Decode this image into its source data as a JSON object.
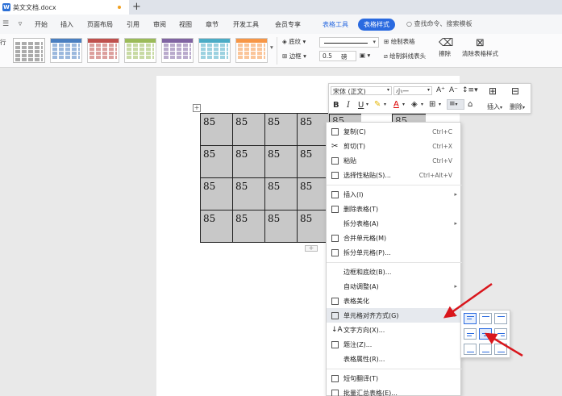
{
  "titlebar": {
    "doc_tab": "英文文档.docx",
    "new_tab_symbol": "+"
  },
  "menubar": {
    "items": [
      "开始",
      "插入",
      "页面布局",
      "引用",
      "审阅",
      "视图",
      "章节",
      "开发工具",
      "会员专享"
    ],
    "context_tab": "表格工具",
    "active_tab": "表格样式",
    "search_placeholder": "查找命令、搜索模板"
  },
  "ribbon": {
    "shading_label": "底纹",
    "border_label": "边框",
    "line_width": "0.5",
    "line_unit": "磅",
    "draw_table_label": "绘制表格",
    "draw_diag_label": "绘制斜线表头",
    "erase_label": "擦除",
    "clear_style_label": "清除表格样式",
    "style_colors": [
      "#555555",
      "#4a7fc1",
      "#c0504d",
      "#9bbb59",
      "#8064a2",
      "#4bacc6",
      "#f79646"
    ]
  },
  "table": {
    "rows": [
      [
        "85",
        "85",
        "85",
        "85"
      ],
      [
        "85",
        "85",
        "85",
        "85"
      ],
      [
        "85",
        "85",
        "85",
        "85"
      ],
      [
        "85",
        "85",
        "85",
        "85"
      ]
    ],
    "partial_cells": [
      "85",
      "85"
    ]
  },
  "minibar": {
    "font_name": "宋体 (正文)",
    "font_size": "小一",
    "insert_label": "插入",
    "delete_label": "删除",
    "bold": "B",
    "italic": "I",
    "underline": "U",
    "font_color": "A"
  },
  "context_menu": {
    "copy": "复制(C)",
    "copy_sc": "Ctrl+C",
    "cut": "剪切(T)",
    "cut_sc": "Ctrl+X",
    "paste": "粘贴",
    "paste_sc": "Ctrl+V",
    "paste_special": "选择性粘贴(S)...",
    "paste_special_sc": "Ctrl+Alt+V",
    "insert": "插入(I)",
    "delete_table": "删除表格(T)",
    "split_table": "拆分表格(A)",
    "merge_cells": "合并单元格(M)",
    "split_cells": "拆分单元格(P)...",
    "borders_shading": "边框和底纹(B)...",
    "autofit": "自动调整(A)",
    "table_beautify": "表格美化",
    "cell_align": "单元格对齐方式(G)",
    "text_direction": "文字方向(X)...",
    "caption": "题注(Z)...",
    "table_props": "表格属性(R)...",
    "translate": "短句翻译(T)",
    "batch": "批量汇总表格(E)..."
  }
}
